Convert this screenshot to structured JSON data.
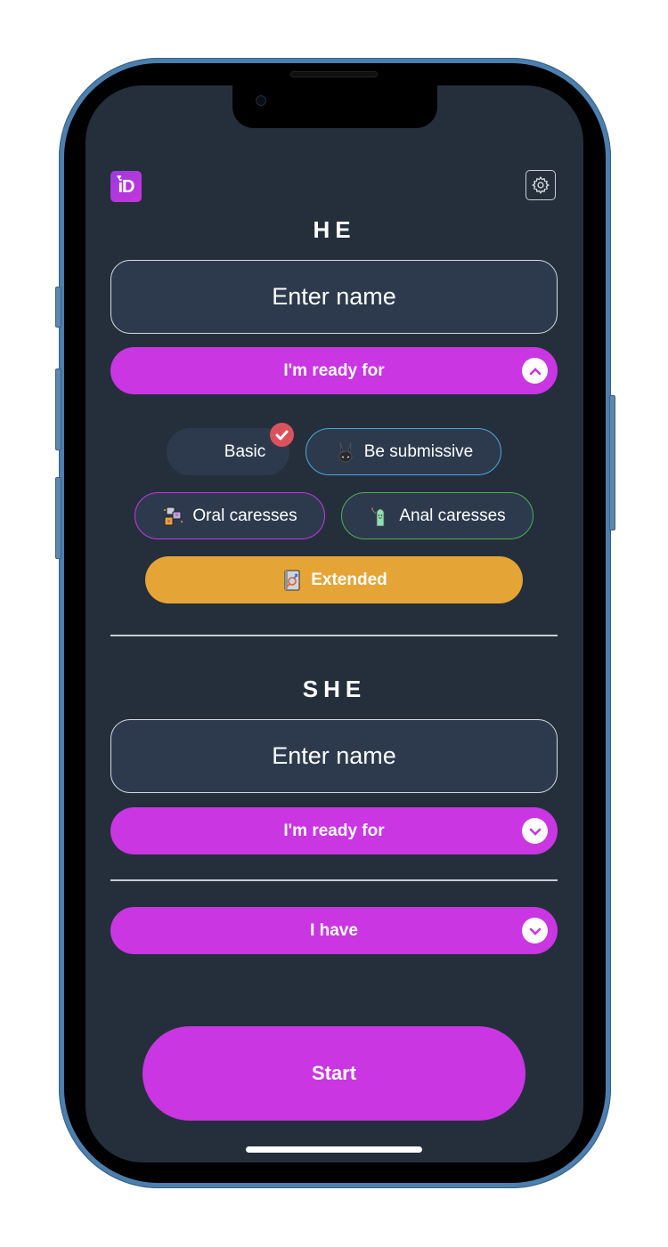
{
  "app": {
    "logo_text": "iD",
    "logo_heart": "♥"
  },
  "colors": {
    "background": "#252f3c",
    "accent": "#c936e2",
    "input_bg": "#2d3a4e",
    "extended": "#e5a536",
    "submissive_border": "#4aa8d8",
    "oral_border": "#c936e2",
    "anal_border": "#4caf50",
    "check_badge": "#d9525e"
  },
  "he": {
    "title": "HE",
    "name_placeholder": "Enter name",
    "name_value": "",
    "ready_dropdown": {
      "label": "I'm ready for",
      "expanded": true
    },
    "options": [
      {
        "label": "Basic",
        "icon": "none",
        "selected": true
      },
      {
        "label": "Be submissive",
        "icon": "bunny-mask-icon",
        "selected": false
      },
      {
        "label": "Oral caresses",
        "icon": "oral-caresses-icon",
        "selected": false
      },
      {
        "label": "Anal caresses",
        "icon": "anal-caresses-icon",
        "selected": false
      },
      {
        "label": "Extended",
        "icon": "gender-book-icon",
        "selected": false
      }
    ]
  },
  "she": {
    "title": "SHE",
    "name_placeholder": "Enter name",
    "name_value": "",
    "ready_dropdown": {
      "label": "I'm ready for",
      "expanded": false
    }
  },
  "have_dropdown": {
    "label": "I have",
    "expanded": false
  },
  "start_button": {
    "label": "Start"
  }
}
